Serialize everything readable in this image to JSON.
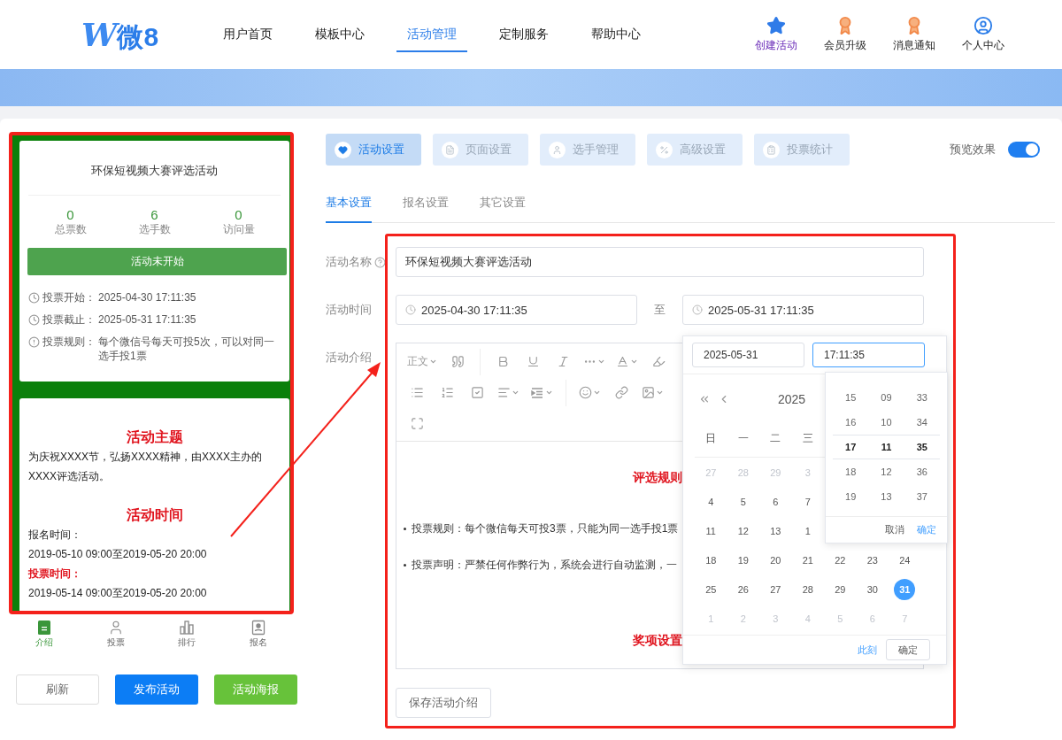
{
  "header": {
    "logo": {
      "mark": "W",
      "name": "微8"
    },
    "nav": [
      {
        "label": "用户首页",
        "selected": false
      },
      {
        "label": "模板中心",
        "selected": false
      },
      {
        "label": "活动管理",
        "selected": true
      },
      {
        "label": "定制服务",
        "selected": false
      },
      {
        "label": "帮助中心",
        "selected": false
      }
    ],
    "actions": [
      {
        "label": "创建活动",
        "kind": "star"
      },
      {
        "label": "会员升级",
        "kind": "badge"
      },
      {
        "label": "消息通知",
        "kind": "badge"
      },
      {
        "label": "个人中心",
        "kind": "user"
      }
    ]
  },
  "preview": {
    "title": "环保短视频大赛评选活动",
    "stats": [
      {
        "value": "0",
        "label": "总票数"
      },
      {
        "value": "6",
        "label": "选手数"
      },
      {
        "value": "0",
        "label": "访问量"
      }
    ],
    "status_button": "活动未开始",
    "info": [
      {
        "kind": "clock",
        "label": "投票开始：",
        "value": "2025-04-30 17:11:35"
      },
      {
        "kind": "clock",
        "label": "投票截止：",
        "value": "2025-05-31 17:11:35"
      },
      {
        "kind": "alert",
        "label": "投票规则：",
        "value": "每个微信号每天可投5次，可以对同一选手投1票"
      }
    ],
    "blocks": [
      {
        "kind": "heading",
        "text": "活动主题"
      },
      {
        "kind": "text",
        "text": "为庆祝XXXX节，弘扬XXXX精神，由XXXX主办的XXXX评选活动。"
      },
      {
        "kind": "heading",
        "text": "活动时间"
      },
      {
        "kind": "text",
        "text": "报名时间："
      },
      {
        "kind": "text",
        "text": "2019-05-10 09:00至2019-05-20 20:00"
      },
      {
        "kind": "label",
        "text": "投票时间："
      },
      {
        "kind": "text",
        "text": "2019-05-14 09:00至2019-05-20 20:00"
      }
    ],
    "tabbar": [
      {
        "label": "介绍",
        "kind": "intro",
        "selected": true
      },
      {
        "label": "投票",
        "kind": "vote",
        "selected": false
      },
      {
        "label": "排行",
        "kind": "rank",
        "selected": false
      },
      {
        "label": "报名",
        "kind": "signup",
        "selected": false
      }
    ]
  },
  "preview_buttons": [
    {
      "label": "刷新",
      "kind": "default"
    },
    {
      "label": "发布活动",
      "kind": "primary"
    },
    {
      "label": "活动海报",
      "kind": "success"
    }
  ],
  "steps": [
    {
      "label": "活动设置",
      "kind": "heart",
      "selected": true
    },
    {
      "label": "页面设置",
      "kind": "page",
      "selected": false
    },
    {
      "label": "选手管理",
      "kind": "user",
      "selected": false
    },
    {
      "label": "高级设置",
      "kind": "advanced",
      "selected": false
    },
    {
      "label": "投票统计",
      "kind": "stats",
      "selected": false
    }
  ],
  "preview_toggle": {
    "label": "预览效果",
    "on": true
  },
  "subtabs": [
    {
      "label": "基本设置",
      "selected": true
    },
    {
      "label": "报名设置",
      "selected": false
    },
    {
      "label": "其它设置",
      "selected": false
    }
  ],
  "form": {
    "name": {
      "label": "活动名称",
      "value": "环保短视频大赛评选活动"
    },
    "time": {
      "label": "活动时间",
      "start": "2025-04-30 17:11:35",
      "separator": "至",
      "end": "2025-05-31 17:11:35"
    },
    "intro": {
      "label": "活动介绍",
      "toolbar": [
        [
          {
            "kind": "paragraph",
            "label": "正文",
            "dropdown": true
          },
          {
            "kind": "quote",
            "dropdown": false
          },
          {
            "kind": "divider"
          },
          {
            "kind": "bold",
            "dropdown": false
          },
          {
            "kind": "underline",
            "dropdown": false
          },
          {
            "kind": "italic",
            "dropdown": false
          },
          {
            "kind": "more",
            "dropdown": true
          },
          {
            "kind": "font-color",
            "dropdown": true
          },
          {
            "kind": "highlight",
            "dropdown": false
          }
        ],
        [
          {
            "kind": "bullet-list",
            "dropdown": false
          },
          {
            "kind": "ordered-list",
            "dropdown": false
          },
          {
            "kind": "todo",
            "dropdown": false
          },
          {
            "kind": "align",
            "dropdown": true
          },
          {
            "kind": "indent",
            "dropdown": true
          },
          {
            "kind": "divider"
          },
          {
            "kind": "emoji",
            "dropdown": true
          },
          {
            "kind": "link",
            "dropdown": false
          },
          {
            "kind": "image",
            "dropdown": true
          }
        ],
        [
          {
            "kind": "fullscreen",
            "dropdown": false
          }
        ]
      ],
      "content": [
        {
          "kind": "heading",
          "text": "评选规则"
        },
        {
          "kind": "bullet",
          "text": "投票规则：每个微信每天可投3票，只能为同一选手投1票"
        },
        {
          "kind": "bullet",
          "text": "投票声明：严禁任何作弊行为，系统会进行自动监测，一"
        },
        {
          "kind": "heading",
          "text": "奖项设置"
        }
      ],
      "save_button": "保存活动介绍"
    }
  },
  "picker": {
    "date_value": "2025-05-31",
    "time_value": "17:11:35",
    "month_title": "2025",
    "weekdays": [
      "日",
      "一",
      "二",
      "三"
    ],
    "weeks": [
      [
        {
          "d": "27",
          "muted": true,
          "selected": false
        },
        {
          "d": "28",
          "muted": true,
          "selected": false
        },
        {
          "d": "29",
          "muted": true,
          "selected": false
        },
        {
          "d": "3",
          "muted": true,
          "selected": false
        }
      ],
      [
        {
          "d": "4",
          "muted": false,
          "selected": false
        },
        {
          "d": "5",
          "muted": false,
          "selected": false
        },
        {
          "d": "6",
          "muted": false,
          "selected": false
        },
        {
          "d": "7",
          "muted": false,
          "selected": false
        }
      ],
      [
        {
          "d": "11",
          "muted": false,
          "selected": false
        },
        {
          "d": "12",
          "muted": false,
          "selected": false
        },
        {
          "d": "13",
          "muted": false,
          "selected": false
        },
        {
          "d": "1",
          "muted": false,
          "selected": false
        }
      ],
      [
        {
          "d": "18",
          "muted": false,
          "selected": false
        },
        {
          "d": "19",
          "muted": false,
          "selected": false
        },
        {
          "d": "20",
          "muted": false,
          "selected": false
        },
        {
          "d": "21",
          "muted": false,
          "selected": false
        },
        {
          "d": "22",
          "muted": false,
          "selected": false
        },
        {
          "d": "23",
          "muted": false,
          "selected": false
        },
        {
          "d": "24",
          "muted": false,
          "selected": false
        }
      ],
      [
        {
          "d": "25",
          "muted": false,
          "selected": false
        },
        {
          "d": "26",
          "muted": false,
          "selected": false
        },
        {
          "d": "27",
          "muted": false,
          "selected": false
        },
        {
          "d": "28",
          "muted": false,
          "selected": false
        },
        {
          "d": "29",
          "muted": false,
          "selected": false
        },
        {
          "d": "30",
          "muted": false,
          "selected": false
        },
        {
          "d": "31",
          "muted": false,
          "selected": true
        }
      ],
      [
        {
          "d": "1",
          "muted": true,
          "selected": false
        },
        {
          "d": "2",
          "muted": true,
          "selected": false
        },
        {
          "d": "3",
          "muted": true,
          "selected": false
        },
        {
          "d": "4",
          "muted": true,
          "selected": false
        },
        {
          "d": "5",
          "muted": true,
          "selected": false
        },
        {
          "d": "6",
          "muted": true,
          "selected": false
        },
        {
          "d": "7",
          "muted": true,
          "selected": false
        }
      ]
    ],
    "now_link": "此刻",
    "ok_button": "确定",
    "time_rows": [
      {
        "h": "15",
        "m": "09",
        "s": "33",
        "selected": false
      },
      {
        "h": "16",
        "m": "10",
        "s": "34",
        "selected": false
      },
      {
        "h": "17",
        "m": "11",
        "s": "35",
        "selected": true
      },
      {
        "h": "18",
        "m": "12",
        "s": "36",
        "selected": false
      },
      {
        "h": "19",
        "m": "13",
        "s": "37",
        "selected": false
      }
    ],
    "time_cancel": "取消",
    "time_ok": "确定"
  }
}
